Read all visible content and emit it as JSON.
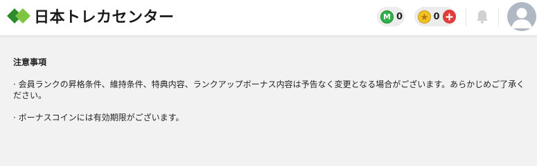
{
  "brand": {
    "name": "日本トレカセンター",
    "logo_color_dark": "#2e8b2e",
    "logo_color_light": "#7ec642"
  },
  "header": {
    "m_coin": {
      "icon": "m-coin-icon",
      "letter": "M",
      "value": "0"
    },
    "star_coin": {
      "icon": "star-coin-icon",
      "value": "0"
    },
    "add_button": {
      "icon": "plus-icon"
    },
    "notifications": {
      "icon": "bell-icon"
    },
    "account": {
      "icon": "avatar-icon"
    }
  },
  "notice": {
    "title": "注意事項",
    "items": [
      "· 会員ランクの昇格条件、維持条件、特典内容、ランクアップボーナス内容は予告なく変更となる場合がございます。あらかじめご了承ください。",
      "· ボーナスコインには有効期限がございます。"
    ]
  },
  "colors": {
    "accent_red": "#e23b3b",
    "coin_green": "#2fb24a",
    "coin_gold": "#f2c21f",
    "page_bg": "#f2f2f2"
  }
}
